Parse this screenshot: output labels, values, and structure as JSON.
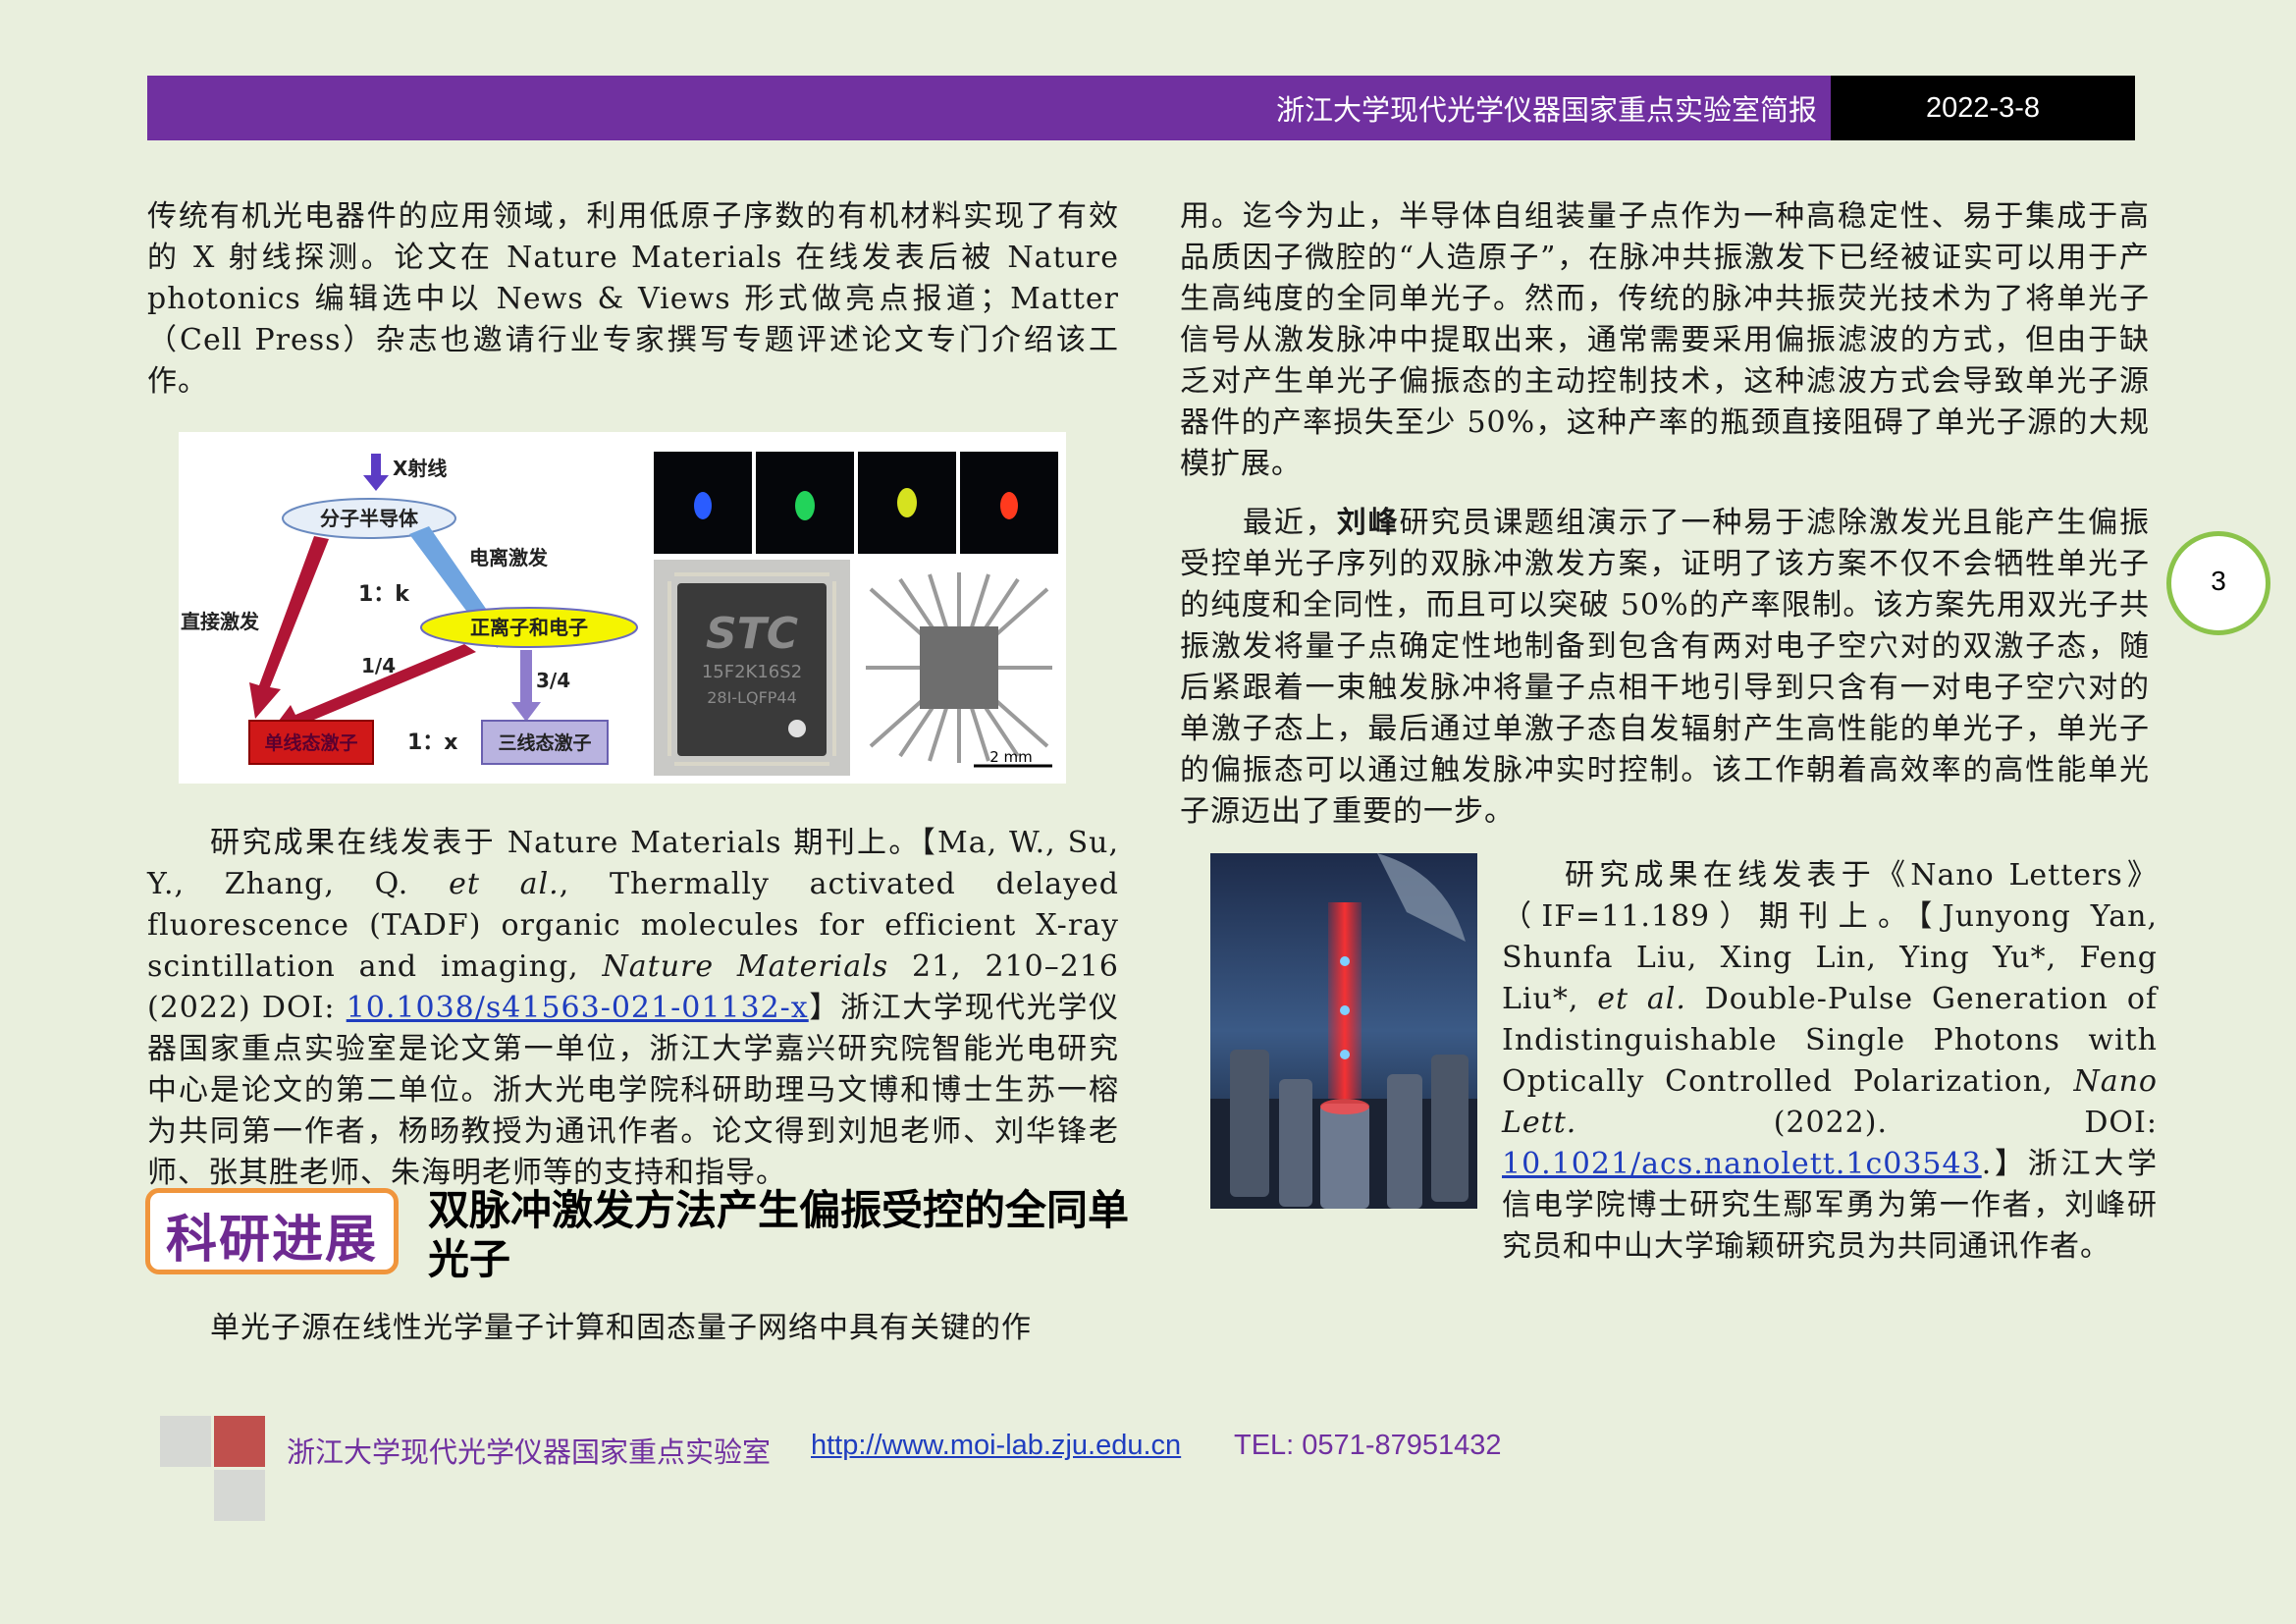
{
  "header": {
    "title": "浙江大学现代光学仪器国家重点实验室简报",
    "date": "2022-3-8"
  },
  "left_column": {
    "para1": "传统有机光电器件的应用领域，利用低原子序数的有机材料实现了有效的 X 射线探测。论文在 Nature Materials 在线发表后被 Nature photonics 编辑选中以 News & Views 形式做亮点报道；Matter （Cell Press）杂志也邀请行业专家撰写专题评述论文专门介绍该工作。",
    "figure1": {
      "label_xray": "X射线",
      "label_molecule": "分子半导体",
      "label_ionization": "电离激发",
      "label_direct": "直接激发",
      "label_1k": "1：k",
      "label_ions": "正离子和电子",
      "label_quarter": "1/4",
      "label_three_quarter": "3/4",
      "label_singlet": "单线态激子",
      "label_1x": "1：x",
      "label_triplet": "三线态激子",
      "chip_text_big": "STC",
      "chip_text_line1": "15F2K16S2",
      "chip_text_line2": "28I-LQFP44",
      "scale_bar": "2 mm",
      "led_colors": [
        "#2a5cff",
        "#22d35a",
        "#d6e21f",
        "#ff3a1e"
      ]
    },
    "para2_pre": "研究成果在线发表于 Nature Materials 期刊上。【Ma, W., Su, Y., Zhang, Q. ",
    "para2_etal": "et al.",
    "para2_mid": ", Thermally activated delayed fluorescence (TADF) organic molecules for efficient X-ray scintillation and imaging, ",
    "para2_journal": "Nature Materials",
    "para2_mid2": " 21, 210–216 (2022)  DOI: ",
    "para2_doi": "10.1038/s41563-021-01132-x",
    "para2_post": "】浙江大学现代光学仪器国家重点实验室是论文第一单位，浙江大学嘉兴研究院智能光电研究中心是论文的第二单位。浙大光电学院科研助理马文博和博士生苏一榕为共同第一作者，杨旸教授为通讯作者。论文得到刘旭老师、刘华锋老师、张其胜老师、朱海明老师等的支持和指导。",
    "section_badge": "科研进展",
    "section_title": "双脉冲激发方法产生偏振受控的全同单光子",
    "para3": "单光子源在线性光学量子计算和固态量子网络中具有关键的作"
  },
  "right_column": {
    "para1": "用。迄今为止，半导体自组装量子点作为一种高稳定性、易于集成于高品质因子微腔的“人造原子”，在脉冲共振激发下已经被证实可以用于产生高纯度的全同单光子。然而，传统的脉冲共振荧光技术为了将单光子信号从激发脉冲中提取出来，通常需要采用偏振滤波的方式，但由于缺乏对产生单光子偏振态的主动控制技术，这种滤波方式会导致单光子源器件的产率损失至少 50%，这种产率的瓶颈直接阻碍了单光子源的大规模扩展。",
    "para2_pre": "最近，",
    "para2_name": "刘峰",
    "para2_post": "研究员课题组演示了一种易于滤除激发光且能产生偏振受控单光子序列的双脉冲激发方案，证明了该方案不仅不会牺牲单光子的纯度和全同性，而且可以突破 50%的产率限制。该方案先用双光子共振激发将量子点确定性地制备到包含有两对电子空穴对的双激子态，随后紧跟着一束触发脉冲将量子点相干地引导到只含有一对电子空穴对的单激子态上，最后通过单激子态自发辐射产生高性能的单光子，单光子的偏振态可以通过触发脉冲实时控制。该工作朝着高效率的高性能单光子源迈出了重要的一步。",
    "para3_pre": "研究成果在线发表于《Nano Letters》（IF=11.189）期刊上。【Junyong Yan, Shunfa Liu, Xing Lin, Ying Yu*, Feng Liu*, ",
    "para3_etal": "et al.",
    "para3_mid": " Double-Pulse Generation of Indistinguishable Single Photons with Optically Controlled Polarization, ",
    "para3_journal": "Nano Lett.",
    "para3_mid2": " (2022). DOI: ",
    "para3_doi": "10.1021/acs.nanolett.1c03543",
    "para3_post": ".】浙江大学信电学院博士研究生鄢军勇为第一作者，刘峰研究员和中山大学瑜颖研究员为共同通讯作者。"
  },
  "page_number": "3",
  "footer": {
    "org": "浙江大学现代光学仪器国家重点实验室",
    "url": "http://www.moi-lab.zju.edu.cn",
    "tel": "TEL: 0571-87951432"
  },
  "colors": {
    "header_purple": "#7030a0",
    "badge_orange": "#f0953c",
    "page_circle_green": "#8bc34a",
    "background": "#e9efdd"
  }
}
